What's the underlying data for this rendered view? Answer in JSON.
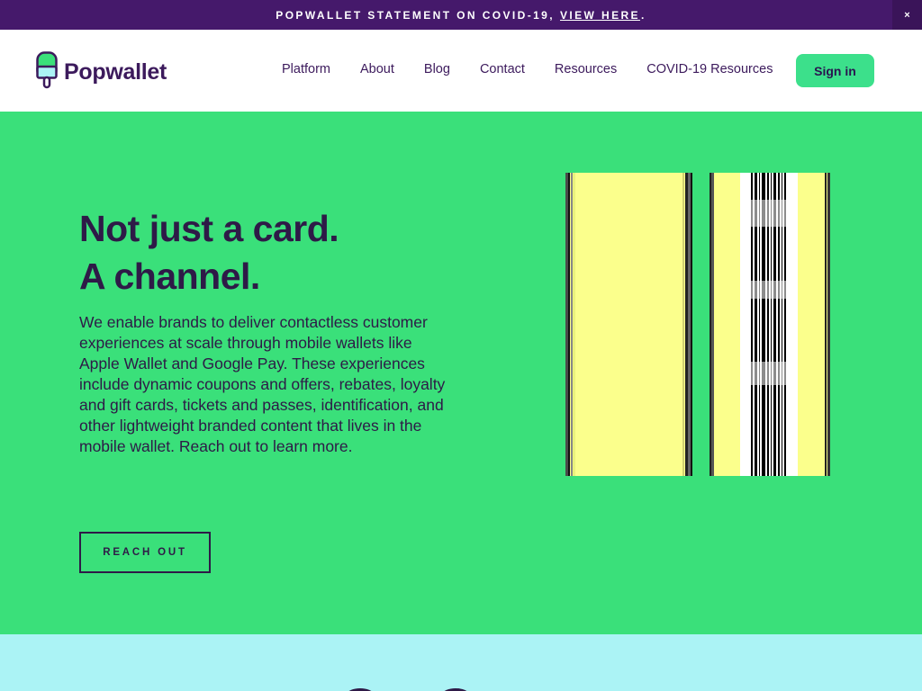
{
  "announcement": {
    "text": "POPWALLET STATEMENT ON COVID-19,",
    "link_label": "VIEW HERE",
    "suffix": ".",
    "close_label": "×"
  },
  "header": {
    "brand": "Popwallet",
    "nav": [
      "Platform",
      "About",
      "Blog",
      "Contact",
      "Resources",
      "COVID-19 Resources"
    ],
    "signin_label": "Sign in"
  },
  "hero": {
    "title_line1": "Not just a card.",
    "title_line2": "A channel.",
    "body": "We enable brands to deliver contactless customer experiences at scale through mobile wallets like Apple Wallet and Google Pay. These experiences include dynamic coupons and offers, rebates, loyalty and gift cards, tickets and passes, identification, and other lightweight branded content that lives in the mobile wallet. Reach out to learn more.",
    "cta_label": "REACH OUT"
  },
  "colors": {
    "announce_bg": "#45196b",
    "brand_purple": "#3c1a5c",
    "hero_green": "#3ae07a",
    "signin_green": "#3ce08b",
    "card_yellow": "#fbff8c",
    "bottom_cyan": "#abf3f5"
  },
  "icons": {
    "logo": "popsicle-logo-icon",
    "close": "close-icon"
  }
}
